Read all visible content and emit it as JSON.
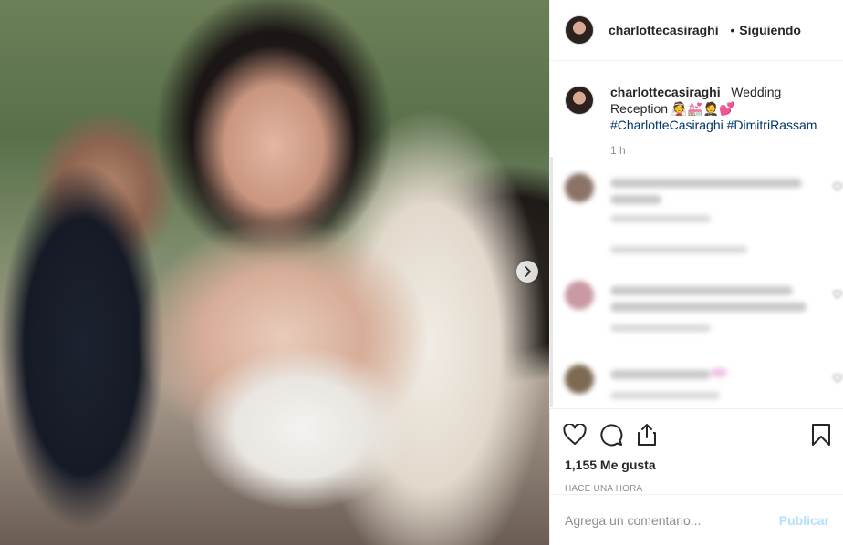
{
  "post": {
    "photo_alt": "",
    "next_icon": "chevron-right-icon"
  },
  "header": {
    "username": "charlottecasiraghi_",
    "separator": "•",
    "follow_label": "Siguiendo"
  },
  "caption": {
    "username": "charlottecasiraghi_",
    "text": " Wedding Reception 👰💒🤵💕",
    "hashtags": [
      "#CharlotteCasiraghi",
      "#DimitriRassam"
    ],
    "time": "1 h"
  },
  "actions": {
    "like_icon": "heart-icon",
    "comment_icon": "comment-icon",
    "share_icon": "share-icon",
    "save_icon": "bookmark-icon",
    "likes": "1,155 Me gusta",
    "timestamp": "HACE UNA HORA"
  },
  "add_comment": {
    "placeholder": "Agrega un comentario...",
    "publish_label": "Publicar"
  },
  "colors": {
    "link": "#003569",
    "muted": "#8e8e8e",
    "publish_disabled": "#b2dffc",
    "border": "#efefef"
  }
}
